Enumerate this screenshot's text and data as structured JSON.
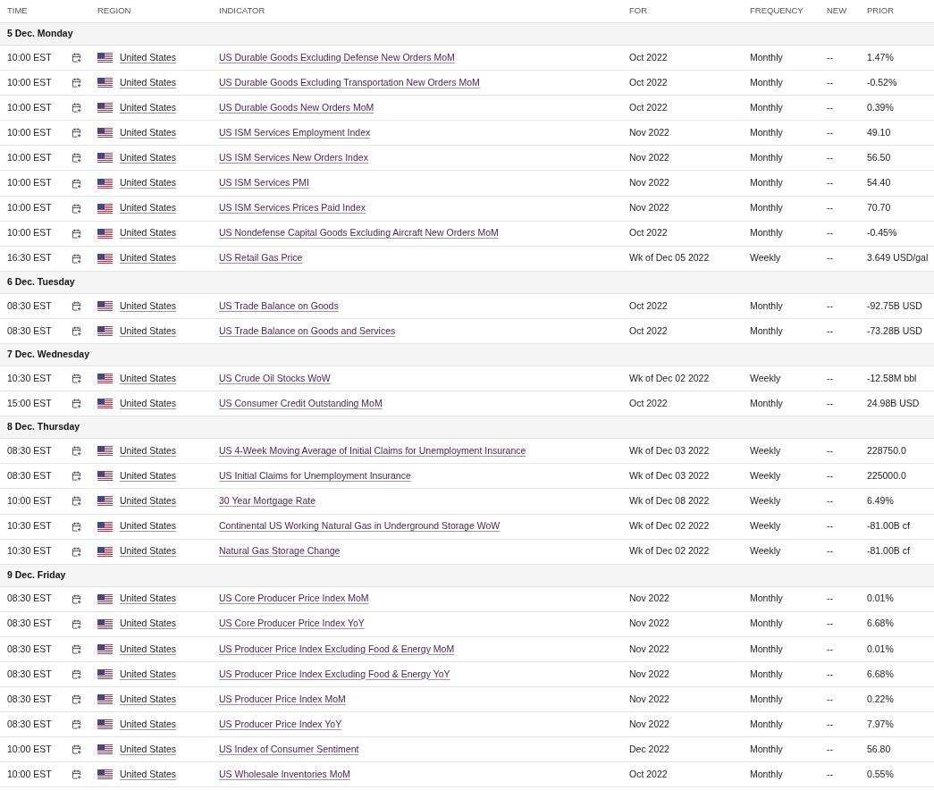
{
  "columns": [
    "TIME",
    "REGION",
    "INDICATOR",
    "FOR",
    "FREQUENCY",
    "NEW",
    "PRIOR"
  ],
  "days": [
    {
      "label": "5 Dec. Monday",
      "events": [
        {
          "time": "10:00 EST",
          "region": "United States",
          "indicator": "US Durable Goods Excluding Defense New Orders MoM",
          "for": "Oct 2022",
          "frequency": "Monthly",
          "new": "--",
          "prior": "1.47%"
        },
        {
          "time": "10:00 EST",
          "region": "United States",
          "indicator": "US Durable Goods Excluding Transportation New Orders MoM",
          "for": "Oct 2022",
          "frequency": "Monthly",
          "new": "--",
          "prior": "-0.52%"
        },
        {
          "time": "10:00 EST",
          "region": "United States",
          "indicator": "US Durable Goods New Orders MoM",
          "for": "Oct 2022",
          "frequency": "Monthly",
          "new": "--",
          "prior": "0.39%"
        },
        {
          "time": "10:00 EST",
          "region": "United States",
          "indicator": "US ISM Services Employment Index",
          "for": "Nov 2022",
          "frequency": "Monthly",
          "new": "--",
          "prior": "49.10"
        },
        {
          "time": "10:00 EST",
          "region": "United States",
          "indicator": "US ISM Services New Orders Index",
          "for": "Nov 2022",
          "frequency": "Monthly",
          "new": "--",
          "prior": "56.50"
        },
        {
          "time": "10:00 EST",
          "region": "United States",
          "indicator": "US ISM Services PMI",
          "for": "Nov 2022",
          "frequency": "Monthly",
          "new": "--",
          "prior": "54.40"
        },
        {
          "time": "10:00 EST",
          "region": "United States",
          "indicator": "US ISM Services Prices Paid Index",
          "for": "Nov 2022",
          "frequency": "Monthly",
          "new": "--",
          "prior": "70.70"
        },
        {
          "time": "10:00 EST",
          "region": "United States",
          "indicator": "US Nondefense Capital Goods Excluding Aircraft New Orders MoM",
          "for": "Oct 2022",
          "frequency": "Monthly",
          "new": "--",
          "prior": "-0.45%"
        },
        {
          "time": "16:30 EST",
          "region": "United States",
          "indicator": "US Retail Gas Price",
          "for": "Wk of Dec 05 2022",
          "frequency": "Weekly",
          "new": "--",
          "prior": "3.649 USD/gal"
        }
      ]
    },
    {
      "label": "6 Dec. Tuesday",
      "events": [
        {
          "time": "08:30 EST",
          "region": "United States",
          "indicator": "US Trade Balance on Goods",
          "for": "Oct 2022",
          "frequency": "Monthly",
          "new": "--",
          "prior": "-92.75B USD"
        },
        {
          "time": "08:30 EST",
          "region": "United States",
          "indicator": "US Trade Balance on Goods and Services",
          "for": "Oct 2022",
          "frequency": "Monthly",
          "new": "--",
          "prior": "-73.28B USD"
        }
      ]
    },
    {
      "label": "7 Dec. Wednesday",
      "events": [
        {
          "time": "10:30 EST",
          "region": "United States",
          "indicator": "US Crude Oil Stocks WoW",
          "for": "Wk of Dec 02 2022",
          "frequency": "Weekly",
          "new": "--",
          "prior": "-12.58M bbl"
        },
        {
          "time": "15:00 EST",
          "region": "United States",
          "indicator": "US Consumer Credit Outstanding MoM",
          "for": "Oct 2022",
          "frequency": "Monthly",
          "new": "--",
          "prior": "24.98B USD"
        }
      ]
    },
    {
      "label": "8 Dec. Thursday",
      "events": [
        {
          "time": "08:30 EST",
          "region": "United States",
          "indicator": "US 4-Week Moving Average of Initial Claims for Unemployment Insurance",
          "for": "Wk of Dec 03 2022",
          "frequency": "Weekly",
          "new": "--",
          "prior": "228750.0"
        },
        {
          "time": "08:30 EST",
          "region": "United States",
          "indicator": "US Initial Claims for Unemployment Insurance",
          "for": "Wk of Dec 03 2022",
          "frequency": "Weekly",
          "new": "--",
          "prior": "225000.0"
        },
        {
          "time": "10:00 EST",
          "region": "United States",
          "indicator": "30 Year Mortgage Rate",
          "for": "Wk of Dec 08 2022",
          "frequency": "Weekly",
          "new": "--",
          "prior": "6.49%"
        },
        {
          "time": "10:30 EST",
          "region": "United States",
          "indicator": "Continental US Working Natural Gas in Underground Storage WoW",
          "for": "Wk of Dec 02 2022",
          "frequency": "Weekly",
          "new": "--",
          "prior": "-81.00B cf"
        },
        {
          "time": "10:30 EST",
          "region": "United States",
          "indicator": "Natural Gas Storage Change",
          "for": "Wk of Dec 02 2022",
          "frequency": "Weekly",
          "new": "--",
          "prior": "-81.00B cf"
        }
      ]
    },
    {
      "label": "9 Dec. Friday",
      "events": [
        {
          "time": "08:30 EST",
          "region": "United States",
          "indicator": "US Core Producer Price Index MoM",
          "for": "Nov 2022",
          "frequency": "Monthly",
          "new": "--",
          "prior": "0.01%"
        },
        {
          "time": "08:30 EST",
          "region": "United States",
          "indicator": "US Core Producer Price Index YoY",
          "for": "Nov 2022",
          "frequency": "Monthly",
          "new": "--",
          "prior": "6.68%"
        },
        {
          "time": "08:30 EST",
          "region": "United States",
          "indicator": "US Producer Price Index Excluding Food & Energy MoM",
          "for": "Nov 2022",
          "frequency": "Monthly",
          "new": "--",
          "prior": "0.01%"
        },
        {
          "time": "08:30 EST",
          "region": "United States",
          "indicator": "US Producer Price Index Excluding Food & Energy YoY",
          "for": "Nov 2022",
          "frequency": "Monthly",
          "new": "--",
          "prior": "6.68%"
        },
        {
          "time": "08:30 EST",
          "region": "United States",
          "indicator": "US Producer Price Index MoM",
          "for": "Nov 2022",
          "frequency": "Monthly",
          "new": "--",
          "prior": "0.22%"
        },
        {
          "time": "08:30 EST",
          "region": "United States",
          "indicator": "US Producer Price Index YoY",
          "for": "Nov 2022",
          "frequency": "Monthly",
          "new": "--",
          "prior": "7.97%"
        },
        {
          "time": "10:00 EST",
          "region": "United States",
          "indicator": "US Index of Consumer Sentiment",
          "for": "Dec 2022",
          "frequency": "Monthly",
          "new": "--",
          "prior": "56.80"
        },
        {
          "time": "10:00 EST",
          "region": "United States",
          "indicator": "US Wholesale Inventories MoM",
          "for": "Oct 2022",
          "frequency": "Monthly",
          "new": "--",
          "prior": "0.55%"
        }
      ]
    }
  ]
}
